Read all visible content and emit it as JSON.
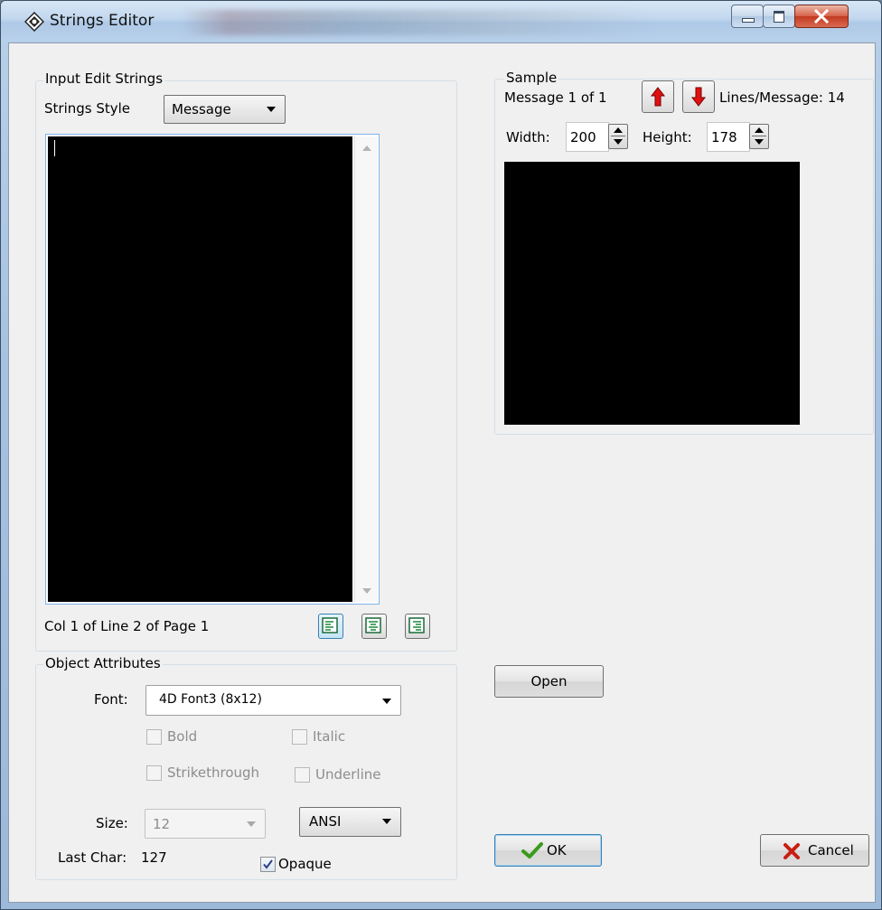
{
  "window": {
    "title": "Strings Editor"
  },
  "input_group": {
    "label": "Input Edit Strings",
    "strings_style_label": "Strings Style",
    "strings_style_value": "Message",
    "cursor_status": "Col 1 of Line 2 of Page 1"
  },
  "sample_group": {
    "label": "Sample",
    "message_counter": "Message 1 of 1",
    "lines_per_message": "Lines/Message: 14",
    "width_label": "Width:",
    "width_value": "200",
    "height_label": "Height:",
    "height_value": "178"
  },
  "object_attributes": {
    "label": "Object Attributes",
    "font_label": "Font:",
    "font_value": "4D Font3 (8x12)",
    "bold_label": "Bold",
    "italic_label": "Italic",
    "strikethrough_label": "Strikethrough",
    "underline_label": "Underline",
    "size_label": "Size:",
    "size_value": "12",
    "charset_value": "ANSI",
    "last_char_label": "Last Char:",
    "last_char_value": "127",
    "opaque_label": "Opaque",
    "opaque_checked": true
  },
  "buttons": {
    "open": "Open",
    "ok": "OK",
    "cancel": "Cancel"
  },
  "colors": {
    "editor_bg": "#000000",
    "sample_bg": "#000000",
    "ok_check": "#3a9a1a",
    "cancel_x": "#c81e12",
    "arrow_red": "#e01010"
  }
}
